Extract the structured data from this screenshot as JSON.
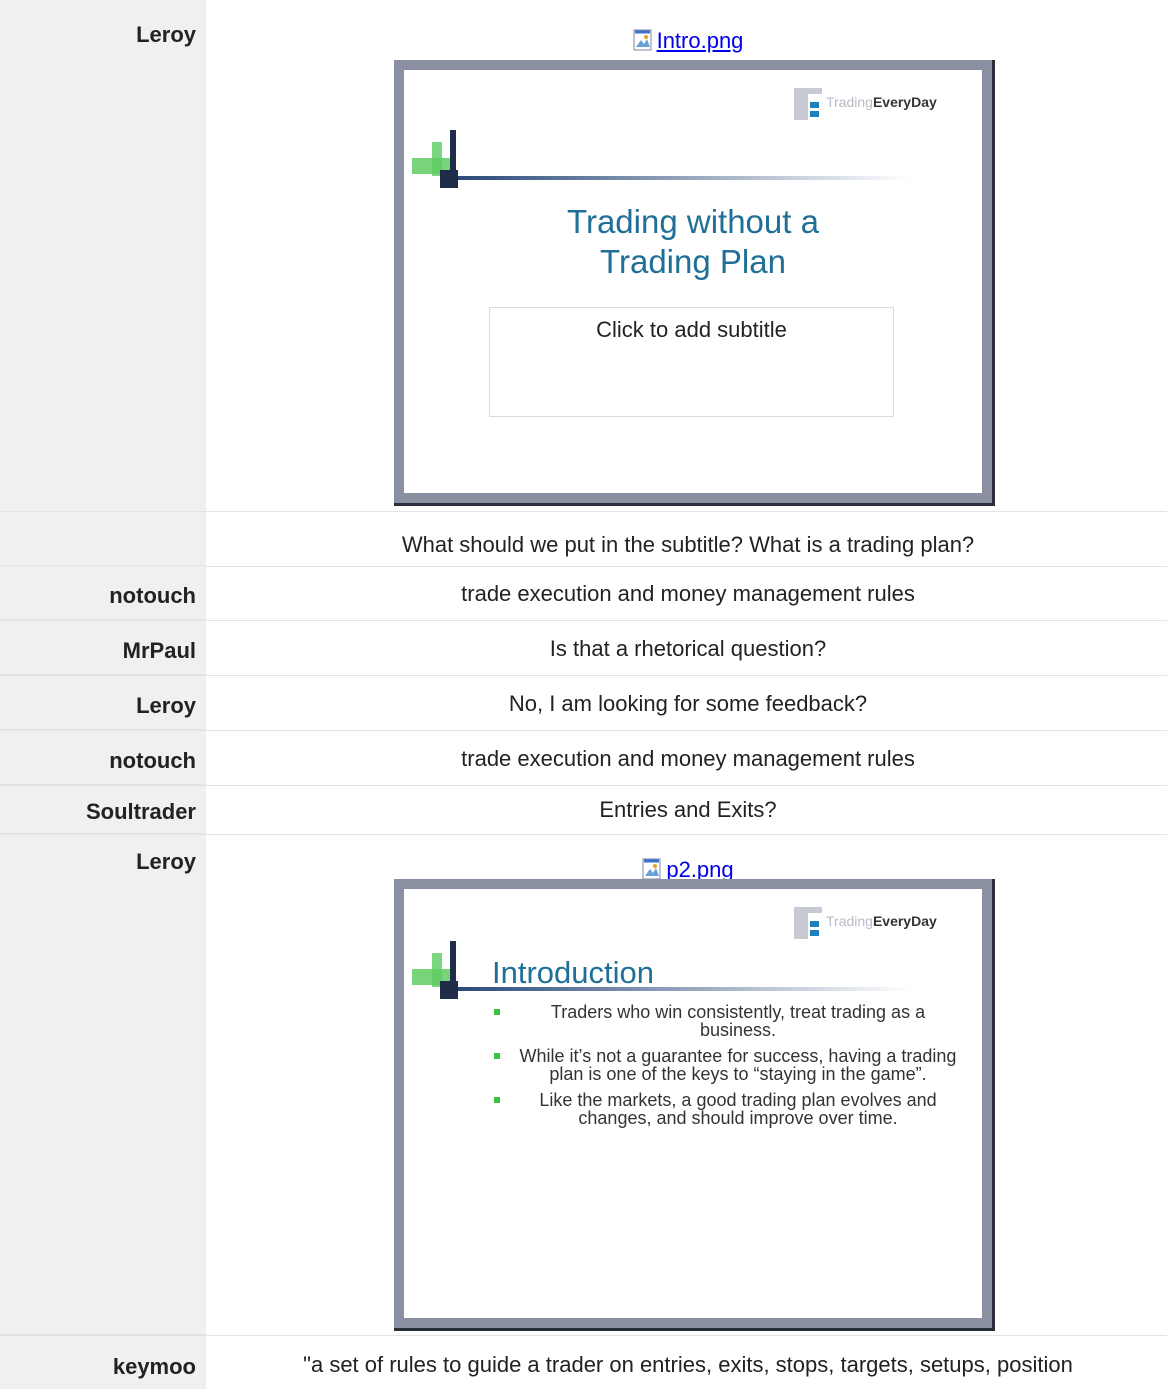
{
  "messages": [
    {
      "user": "Leroy",
      "attachment": {
        "filename": "Intro.png",
        "slide": {
          "title": "Trading without a\nTrading Plan",
          "subtitle_placeholder": "Click to add subtitle",
          "logo_light": "Trading",
          "logo_bold": "EveryDay"
        }
      }
    },
    {
      "user": "",
      "text": "What should we put in the subtitle? What is a trading plan?"
    },
    {
      "user": "notouch",
      "text": "trade execution and money management rules"
    },
    {
      "user": "MrPaul",
      "text": "Is that a rhetorical question?"
    },
    {
      "user": "Leroy",
      "text": "No, I am looking for some feedback?"
    },
    {
      "user": "notouch",
      "text": "trade execution and money management rules"
    },
    {
      "user": "Soultrader",
      "text": "Entries and Exits?"
    },
    {
      "user": "Leroy",
      "attachment": {
        "filename": "p2.png",
        "slide": {
          "title": "Introduction",
          "logo_light": "Trading",
          "logo_bold": "EveryDay",
          "bullets": [
            "Traders who win consistently, treat trading as a business.",
            "While it’s not a guarantee for success, having a trading plan is one of the keys to “staying in the game”.",
            "Like the markets, a good trading plan evolves and changes, and should improve over time."
          ]
        }
      }
    },
    {
      "user": "keymoo",
      "text": "\"a set of rules to guide a trader on entries, exits, stops, targets, setups, position"
    }
  ],
  "colors": {
    "name_column_bg": "#f0f0f0",
    "link": "#0000ee",
    "slide_title": "#1f6f97",
    "bullet": "#39c43e",
    "slide_frame": "#8a8fa2"
  },
  "icons": {
    "attachment": "image-file-icon",
    "logo": "trading-everyday-logo"
  }
}
